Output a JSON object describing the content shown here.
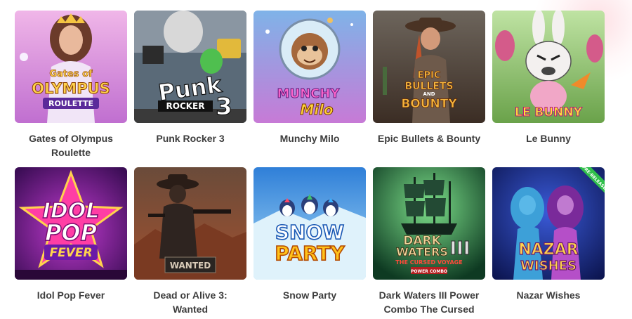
{
  "games": [
    {
      "title": "Gates of Olympus Roulette",
      "logo": [
        "Gates of",
        "OLYMPUS",
        "ROULETTE"
      ]
    },
    {
      "title": "Punk Rocker 3",
      "logo": [
        "Punk",
        "ROCKER",
        "3"
      ]
    },
    {
      "title": "Munchy Milo",
      "logo": [
        "MUNCHY",
        "Milo"
      ]
    },
    {
      "title": "Epic Bullets & Bounty",
      "logo": [
        "EPIC",
        "BULLETS",
        "AND",
        "BOUNTY"
      ]
    },
    {
      "title": "Le Bunny",
      "logo": [
        "LE BUNNY"
      ]
    },
    {
      "title": "Idol Pop Fever",
      "logo": [
        "IDOL",
        "POP",
        "FEVER"
      ]
    },
    {
      "title": "Dead or Alive 3: Wanted",
      "logo": [
        "WANTED"
      ]
    },
    {
      "title": "Snow Party",
      "logo": [
        "SNOW",
        "PARTY"
      ]
    },
    {
      "title": "Dark Waters III Power Combo The Cursed Voyage",
      "logo": [
        "DARK",
        "WATERS",
        "III",
        "THE CURSED VOYAGE",
        "POWER COMBO"
      ]
    },
    {
      "title": "Nazar Wishes",
      "logo": [
        "NAZAR",
        "WISHES"
      ],
      "ribbon": "PRE-RELEASE"
    }
  ]
}
